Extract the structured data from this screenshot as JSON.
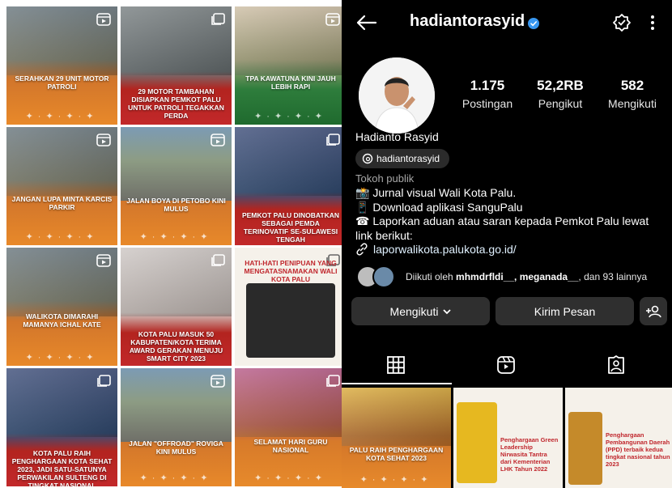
{
  "grid": [
    {
      "caption": "SERAHKAN 29 UNIT MOTOR PATROLI",
      "icon": "reels-icon"
    },
    {
      "caption": "29 MOTOR TAMBAHAN DISIAPKAN PEMKOT PALU UNTUK PATROLI TEGAKKAN PERDA",
      "icon": "carousel-icon"
    },
    {
      "caption": "TPA KAWATUNA KINI JAUH LEBIH RAPI",
      "icon": "reels-icon"
    },
    {
      "caption": "JANGAN LUPA MINTA KARCIS PARKIR",
      "icon": "reels-icon"
    },
    {
      "caption": "JALAN BOYA DI PETOBO KINI MULUS",
      "icon": "reels-icon"
    },
    {
      "caption": "PEMKOT PALU DINOBATKAN SEBAGAI PEMDA TERINOVATIF SE-SULAWESI TENGAH",
      "icon": "carousel-icon"
    },
    {
      "caption": "WALIKOTA DIMARAHI MAMANYA ICHAL KATE",
      "icon": "reels-icon"
    },
    {
      "caption": "KOTA PALU MASUK 50 KABUPATEN/KOTA TERIMA AWARD GERAKAN MENUJU SMART CITY 2023",
      "icon": "carousel-icon"
    },
    {
      "caption": "HATI-HATI PENIPUAN YANG MENGATASNAMAKAN WALI KOTA PALU",
      "icon": "carousel-icon"
    },
    {
      "caption": "KOTA PALU RAIH PENGHARGAAN KOTA SEHAT 2023, JADI SATU-SATUNYA PERWAKILAN SULTENG DI TINGKAT NASIONAL",
      "icon": "carousel-icon"
    },
    {
      "caption": "JALAN \"OFFROAD\" ROVIGA KINI MULUS",
      "icon": "reels-icon"
    },
    {
      "caption": "SELAMAT HARI GURU NASIONAL",
      "icon": "carousel-icon"
    }
  ],
  "profile": {
    "username": "hadiantorasyid",
    "stats": [
      {
        "value": "1.175",
        "label": "Postingan"
      },
      {
        "value": "52,2RB",
        "label": "Pengikut"
      },
      {
        "value": "582",
        "label": "Mengikuti"
      }
    ],
    "display_name": "Hadianto Rasyid",
    "threads_handle": "hadiantorasyid",
    "category": "Tokoh publik",
    "bio": [
      "📸 Jurnal visual Wali Kota Palu.",
      "📱 Download aplikasi SanguPalu",
      "☎ Laporkan aduan atau saran kepada Pemkot Palu lewat link berikut:"
    ],
    "link": "laporwalikota.palukota.go.id/",
    "followed_by_prefix": "Diikuti oleh ",
    "followed_by_names": "mhmdrfldi__, meganada__",
    "followed_by_suffix": ", dan 93 lainnya",
    "follow_button": "Mengikuti",
    "message_button": "Kirim Pesan"
  },
  "strip": [
    {
      "caption": "PALU RAIH PENGHARGAAN KOTA SEHAT 2023"
    },
    {
      "caption": "Penghargaan Green Leadership Nirwasita Tantra dari Kementerian LHK Tahun 2022"
    },
    {
      "caption": "Penghargaan Pembangunan Daerah (PPD) terbaik kedua tingkat nasional tahun 2023"
    }
  ],
  "colors": {
    "accent_orange": "#e8892a",
    "verified_blue": "#3897f0",
    "button_bg": "#2f2f2f"
  }
}
